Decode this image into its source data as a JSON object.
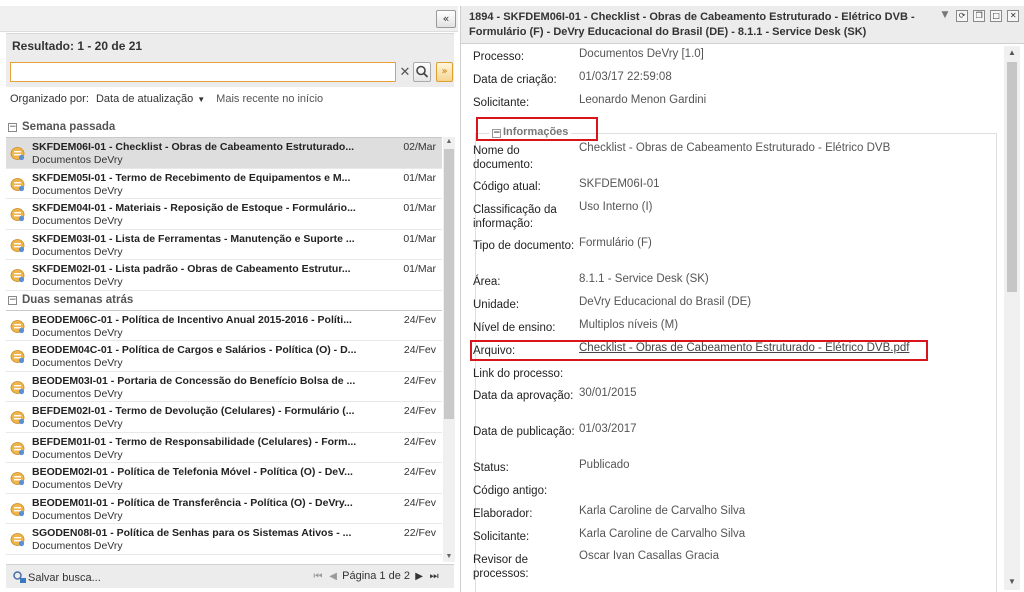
{
  "left": {
    "collapse_label": "«",
    "results_label": "Resultado: 1 - 20 de 21",
    "search": {
      "value": "",
      "placeholder": ""
    },
    "sort": {
      "prefix": "Organizado por:",
      "field": "Data de atualização",
      "order": "Mais recente no início"
    },
    "groups": [
      {
        "label": "Semana passada",
        "items": [
          {
            "title": "SKFDEM06I-01 - Checklist - Obras de Cabeamento Estruturado...",
            "sub": "Documentos DeVry",
            "date": "02/Mar",
            "selected": true
          },
          {
            "title": "SKFDEM05I-01 - Termo de Recebimento de Equipamentos e M...",
            "sub": "Documentos DeVry",
            "date": "01/Mar"
          },
          {
            "title": "SKFDEM04I-01 - Materiais - Reposição de Estoque - Formulário...",
            "sub": "Documentos DeVry",
            "date": "01/Mar"
          },
          {
            "title": "SKFDEM03I-01 - Lista de Ferramentas - Manutenção e Suporte ...",
            "sub": "Documentos DeVry",
            "date": "01/Mar"
          },
          {
            "title": "SKFDEM02I-01 - Lista padrão - Obras de Cabeamento Estrutur...",
            "sub": "Documentos DeVry",
            "date": "01/Mar"
          }
        ]
      },
      {
        "label": "Duas semanas atrás",
        "items": [
          {
            "title": "BEODEM06C-01 - Política de Incentivo Anual 2015-2016 - Políti...",
            "sub": "Documentos DeVry",
            "date": "24/Fev"
          },
          {
            "title": "BEODEM04C-01 - Política de Cargos e Salários - Política (O) - D...",
            "sub": "Documentos DeVry",
            "date": "24/Fev"
          },
          {
            "title": "BEODEM03I-01 - Portaria de Concessão do Benefício Bolsa de ...",
            "sub": "Documentos DeVry",
            "date": "24/Fev"
          },
          {
            "title": "BEFDEM02I-01 - Termo de Devolução (Celulares) - Formulário (...",
            "sub": "Documentos DeVry",
            "date": "24/Fev"
          },
          {
            "title": "BEFDEM01I-01 - Termo de Responsabilidade (Celulares) - Form...",
            "sub": "Documentos DeVry",
            "date": "24/Fev"
          },
          {
            "title": "BEODEM02I-01 - Política de Telefonia Móvel - Política (O) - DeV...",
            "sub": "Documentos DeVry",
            "date": "24/Fev"
          },
          {
            "title": "BEODEM01I-01 - Política de Transferência - Política (O) - DeVry...",
            "sub": "Documentos DeVry",
            "date": "24/Fev"
          },
          {
            "title": "SGODEN08I-01 - Política de Senhas para os Sistemas Ativos - ...",
            "sub": "Documentos DeVry",
            "date": "22/Fev"
          }
        ]
      }
    ],
    "save_search": "Salvar busca...",
    "pager": {
      "label": "Página 1 de 2"
    }
  },
  "right": {
    "title": "1894 - SKFDEM06I-01 - Checklist - Obras de Cabeamento Estruturado - Elétrico DVB - Formulário (F) - DeVry Educacional do Brasil (DE) - 8.1.1 - Service Desk (SK)",
    "top_fields": [
      {
        "label": "Processo:",
        "value": "Documentos DeVry [1.0]"
      },
      {
        "label": "Data de criação:",
        "value": "01/03/17 22:59:08"
      },
      {
        "label": "Solicitante:",
        "value": "Leonardo Menon Gardini"
      }
    ],
    "info_legend": "Informações",
    "info_fields": [
      {
        "label": "Nome do documento:",
        "value": "Checklist - Obras de Cabeamento Estruturado - Elétrico DVB"
      },
      {
        "label": "Código atual:",
        "value": "SKFDEM06I-01"
      },
      {
        "label": "Classificação da informação:",
        "value": "Uso Interno (I)"
      },
      {
        "label": "Tipo de documento:",
        "value": "Formulário (F)"
      },
      {
        "label": "Área:",
        "value": "8.1.1 - Service Desk (SK)"
      },
      {
        "label": "Unidade:",
        "value": "DeVry Educacional do Brasil (DE)"
      },
      {
        "label": "Nível de ensino:",
        "value": "Multiplos níveis (M)"
      },
      {
        "label": "Arquivo:",
        "value": "Checklist - Obras de Cabeamento Estruturado - Elétrico DVB.pdf",
        "link": true
      },
      {
        "label": "Link do processo:",
        "value": ""
      },
      {
        "label": "Data da aprovação:",
        "value": "30/01/2015"
      },
      {
        "label": "Data de publicação:",
        "value": "01/03/2017"
      },
      {
        "label": "Status:",
        "value": "Publicado"
      },
      {
        "label": "Código antigo:",
        "value": ""
      },
      {
        "label": "Elaborador:",
        "value": "Karla Caroline de Carvalho Silva"
      },
      {
        "label": "Solicitante:",
        "value": "Karla Caroline de Carvalho Silva"
      },
      {
        "label": "Revisor de processos:",
        "value": "Oscar Ivan Casallas Gracia"
      }
    ]
  }
}
